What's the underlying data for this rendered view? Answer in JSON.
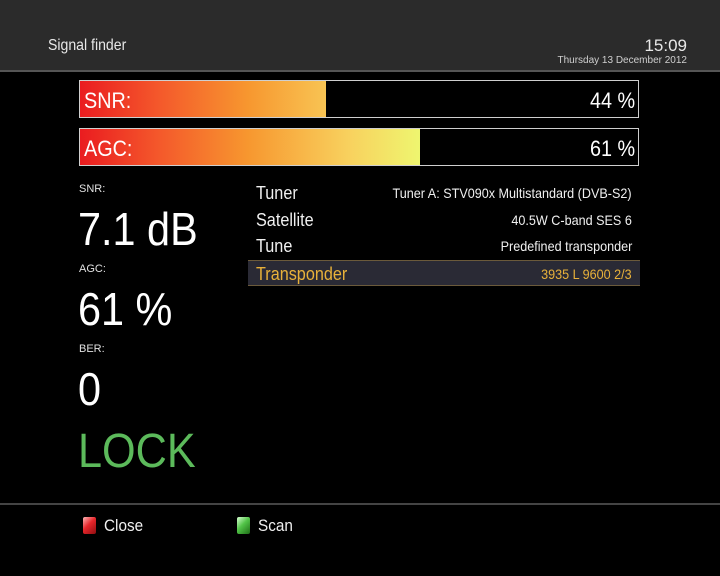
{
  "header": {
    "title": "Signal finder",
    "time": "15:09",
    "date": "Thursday 13 December 2012"
  },
  "meters": {
    "snr": {
      "label": "SNR:",
      "value_text": "44 %",
      "value": 44
    },
    "agc": {
      "label": "AGC:",
      "value_text": "61 %",
      "value": 61
    }
  },
  "stats": {
    "snr_label": "SNR:",
    "snr_value": "7.1 dB",
    "agc_label": "AGC:",
    "agc_value": "61 %",
    "ber_label": "BER:",
    "ber_value": "0",
    "lock_status": "LOCK"
  },
  "settings": [
    {
      "key": "Tuner",
      "value": "Tuner A: STV090x Multistandard (DVB-S2)"
    },
    {
      "key": "Satellite",
      "value": "40.5W C-band SES 6"
    },
    {
      "key": "Tune",
      "value": "Predefined transponder"
    },
    {
      "key": "Transponder",
      "value": "3935 L 9600 2/3",
      "selected": true
    }
  ],
  "footer": {
    "close_label": "Close",
    "scan_label": "Scan"
  },
  "colors": {
    "lock": "#5cba5b",
    "selected_text": "#e8b13a",
    "red_key": "#e7262b",
    "green_key": "#52c448"
  }
}
